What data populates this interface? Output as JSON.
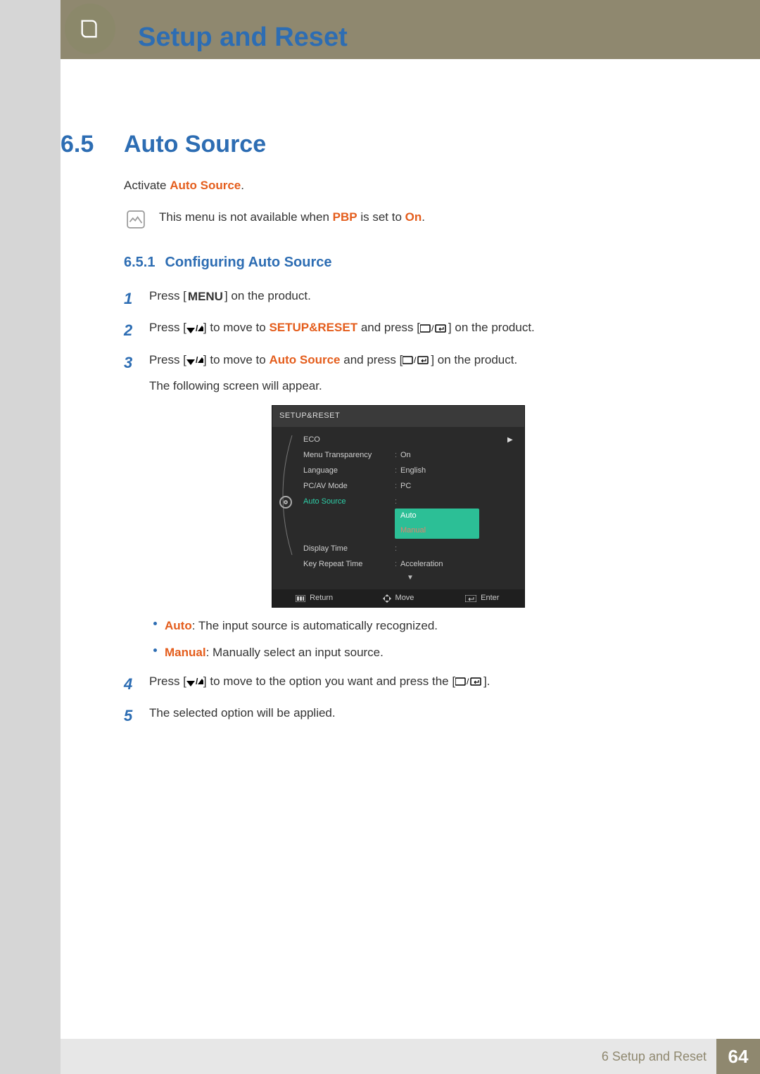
{
  "chapter": {
    "title": "Setup and Reset"
  },
  "section": {
    "number": "6.5",
    "title": "Auto Source"
  },
  "intro": {
    "prefix": "Activate ",
    "term": "Auto Source",
    "suffix": "."
  },
  "note": {
    "pre": "This menu is not available when ",
    "term1": "PBP",
    "mid": " is set to ",
    "term2": "On",
    "post": "."
  },
  "subsection": {
    "number": "6.5.1",
    "title": "Configuring Auto Source"
  },
  "steps": {
    "s1": {
      "num": "1",
      "pre": "Press [",
      "key": "MENU",
      "post": "] on the product."
    },
    "s2": {
      "num": "2",
      "pre": "Press [",
      "mid1": "] to move to ",
      "target": "SETUP&RESET",
      "mid2": " and press [",
      "post": "] on the product."
    },
    "s3": {
      "num": "3",
      "pre": "Press [",
      "mid1": "] to move to ",
      "target": "Auto Source",
      "mid2": " and press [",
      "post": "] on the product.",
      "follow": "The following screen will appear."
    },
    "s4": {
      "num": "4",
      "pre": "Press [",
      "mid1": "] to move to the option you want and press the [",
      "post": "]."
    },
    "s5": {
      "num": "5",
      "text": "The selected option will be applied."
    }
  },
  "osd": {
    "title": "SETUP&RESET",
    "rows": [
      {
        "label": "ECO",
        "value": "",
        "arrow": true
      },
      {
        "label": "Menu Transparency",
        "value": "On"
      },
      {
        "label": "Language",
        "value": "English"
      },
      {
        "label": "PC/AV Mode",
        "value": "PC"
      },
      {
        "label": "Auto Source",
        "highlight": true,
        "dropdown": [
          "Auto",
          "Manual"
        ]
      },
      {
        "label": "Display Time",
        "value": ""
      },
      {
        "label": "Key Repeat Time",
        "value": "Acceleration"
      }
    ],
    "footer": {
      "return": "Return",
      "move": "Move",
      "enter": "Enter"
    }
  },
  "bullets": {
    "b1": {
      "term": "Auto",
      "text": ": The input source is automatically recognized."
    },
    "b2": {
      "term": "Manual",
      "text": ": Manually select an input source."
    }
  },
  "footer": {
    "chapter_ref": "6 Setup and Reset",
    "page": "64"
  }
}
